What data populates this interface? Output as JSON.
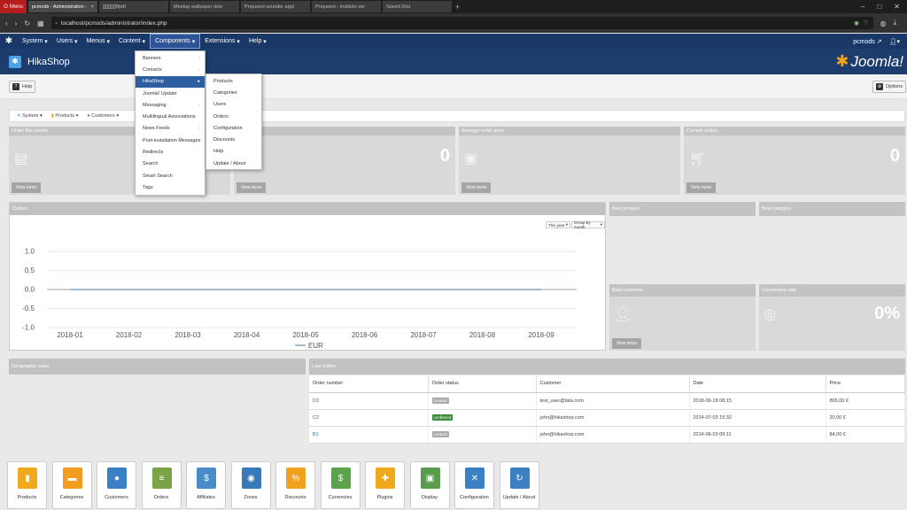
{
  "browser": {
    "menu_label": "Menu",
    "tabs": [
      {
        "label": "pcmods - Administration -"
      },
      {
        "label": "[][][][][]ffpdf"
      },
      {
        "label": "Meetup wallpaper dow"
      },
      {
        "label": "Prepared sounder appl"
      },
      {
        "label": "Prepared - Instituto ver"
      },
      {
        "label": "Speed Dial"
      }
    ],
    "url": "localhost/pcmods/administrator/index.php"
  },
  "joomla_menu": {
    "items": [
      "System",
      "Users",
      "Menus",
      "Content",
      "Components",
      "Extensions",
      "Help"
    ],
    "site_name": "pcmods",
    "brand": "Joomla!"
  },
  "header": {
    "title": "HikaShop"
  },
  "toolbar": {
    "help": "Help",
    "options": "Options"
  },
  "hika_nav": [
    "System",
    "Products",
    "Customers"
  ],
  "components_menu": [
    {
      "label": "Banners",
      "sub": true
    },
    {
      "label": "Contacts",
      "sub": true
    },
    {
      "label": "HikaShop",
      "sub": true
    },
    {
      "label": "Joomla! Update",
      "sub": false
    },
    {
      "label": "Messaging",
      "sub": true
    },
    {
      "label": "Multilingual Associations",
      "sub": false
    },
    {
      "label": "News Feeds",
      "sub": true
    },
    {
      "label": "Post-installation Messages",
      "sub": false
    },
    {
      "label": "Redirects",
      "sub": false
    },
    {
      "label": "Search",
      "sub": false
    },
    {
      "label": "Smart Search",
      "sub": false
    },
    {
      "label": "Tags",
      "sub": false
    }
  ],
  "hikashop_submenu": [
    "Products",
    "Categories",
    "Users",
    "Orders",
    "Configuration",
    "Discounts",
    "Help",
    "Update / About"
  ],
  "tiles": {
    "order_month": {
      "title": "Order this month",
      "view": "View more"
    },
    "second": {
      "value": "0",
      "view": "View more"
    },
    "avg_price": {
      "title": "Average order price",
      "view": "View more"
    },
    "current": {
      "title": "Current orders",
      "value": "0",
      "view": "View more"
    },
    "best_product": {
      "title": "Best product"
    },
    "best_category": {
      "title": "Best category"
    },
    "best_customer": {
      "title": "Best customer",
      "view": "View more"
    },
    "conversion": {
      "title": "Conversion rate",
      "value": "0%"
    }
  },
  "orders_panel": {
    "title": "Orders",
    "year_select": "This year",
    "group_select": "Group by month"
  },
  "chart_data": {
    "type": "line",
    "x": [
      "2018-01",
      "2018-02",
      "2018-03",
      "2018-04",
      "2018-05",
      "2018-06",
      "2018-07",
      "2018-08",
      "2018-09"
    ],
    "series": [
      {
        "name": "EUR",
        "values": [
          0,
          0,
          0,
          0,
          0,
          0,
          0,
          0,
          0
        ]
      }
    ],
    "yticks": [
      "1.0",
      "0.5",
      "0.0",
      "-0.5",
      "-1.0"
    ],
    "ylim": [
      -1,
      1
    ],
    "grid": true,
    "legend": "bottom",
    "color": "#6a8fb4"
  },
  "geo": {
    "title": "Geographic sales"
  },
  "last_orders": {
    "title": "Last orders",
    "columns": [
      "Order number",
      "Order status",
      "Customer",
      "Date",
      "Price"
    ],
    "rows": [
      {
        "number": "D3",
        "status": "created",
        "status_color": "#aaaaaa",
        "customer": "test_user@tata.com",
        "date": "2018-06-18 08:15",
        "price": "865,00 €"
      },
      {
        "number": "C2",
        "status": "confirmed",
        "status_color": "#3a8a3a",
        "customer": "john@hikashop.com",
        "date": "2014-07-03 15:32",
        "price": "20,00 €"
      },
      {
        "number": "B1",
        "status": "created",
        "status_color": "#aaaaaa",
        "customer": "john@hikashop.com",
        "date": "2014-06-03 09:11",
        "price": "84,00 €"
      }
    ]
  },
  "dock": [
    {
      "label": "Products",
      "color": "#f0a81c",
      "icon": "▮"
    },
    {
      "label": "Categories",
      "color": "#f29d1f",
      "icon": "▬"
    },
    {
      "label": "Customers",
      "color": "#3b7fc4",
      "icon": "●"
    },
    {
      "label": "Orders",
      "color": "#7aa347",
      "icon": "≡"
    },
    {
      "label": "Affiliates",
      "color": "#4a8cc9",
      "icon": "$"
    },
    {
      "label": "Zones",
      "color": "#3979b8",
      "icon": "◉"
    },
    {
      "label": "Discounts",
      "color": "#f0a21e",
      "icon": "%"
    },
    {
      "label": "Currencies",
      "color": "#5aa34b",
      "icon": "$"
    },
    {
      "label": "Plugins",
      "color": "#f0a81c",
      "icon": "✚"
    },
    {
      "label": "Display",
      "color": "#5a9c4b",
      "icon": "▣"
    },
    {
      "label": "Configuration",
      "color": "#3b7fc4",
      "icon": "✕"
    },
    {
      "label": "Update / About",
      "color": "#3b7fc4",
      "icon": "↻"
    }
  ]
}
